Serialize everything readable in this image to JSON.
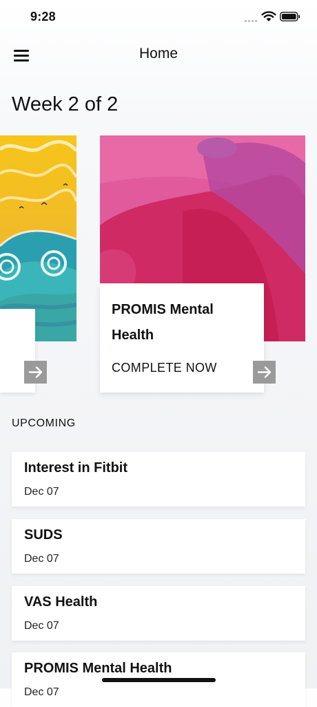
{
  "status_bar": {
    "time": "9:28"
  },
  "nav": {
    "title": "Home",
    "menu_icon": "hamburger-menu-icon"
  },
  "week": {
    "heading": "Week 2 of 2"
  },
  "carousel": {
    "active_card": {
      "title": "PROMIS Mental Health",
      "cta": "COMPLETE NOW",
      "arrow_icon": "arrow-right-icon"
    },
    "colors": {
      "arrow_bg": "#9a9a9a",
      "art_pink": "#e04f94",
      "art_red": "#c9184a",
      "art_yellow": "#f3c61c",
      "art_teal": "#2aa3b6"
    }
  },
  "upcoming": {
    "label": "UPCOMING",
    "items": [
      {
        "title": "Interest in Fitbit",
        "date": "Dec 07"
      },
      {
        "title": "SUDS",
        "date": "Dec 07"
      },
      {
        "title": "VAS Health",
        "date": "Dec 07"
      },
      {
        "title": "PROMIS Mental Health",
        "date": "Dec 07"
      }
    ]
  }
}
